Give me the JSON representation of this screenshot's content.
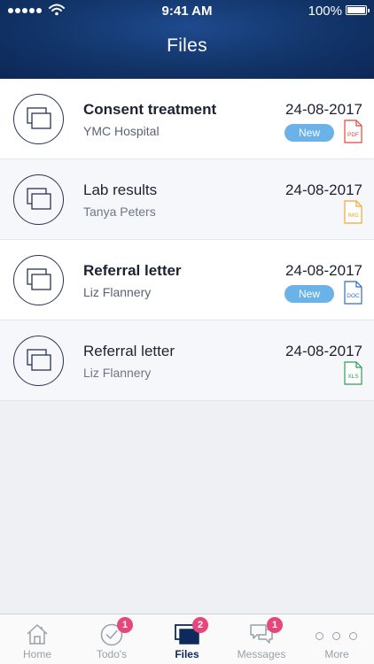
{
  "status_bar": {
    "time": "9:41 AM",
    "battery": "100%"
  },
  "header": {
    "title": "Files"
  },
  "files": [
    {
      "title": "Consent treatment",
      "subtitle": "YMC Hospital",
      "date": "24-08-2017",
      "badge": "New",
      "file_type": "PDF",
      "file_color": "#e0473a",
      "unread": true
    },
    {
      "title": "Lab results",
      "subtitle": "Tanya Peters",
      "date": "24-08-2017",
      "badge": "",
      "file_type": "IMG",
      "file_color": "#f0a830",
      "unread": false
    },
    {
      "title": "Referral letter",
      "subtitle": "Liz Flannery",
      "date": "24-08-2017",
      "badge": "New",
      "file_type": "DOC",
      "file_color": "#2f6fb7",
      "unread": true
    },
    {
      "title": "Referral letter",
      "subtitle": "Liz Flannery",
      "date": "24-08-2017",
      "badge": "",
      "file_type": "XLS",
      "file_color": "#2e9e57",
      "unread": false
    }
  ],
  "tabs": [
    {
      "label": "Home",
      "icon": "home-icon",
      "badge": ""
    },
    {
      "label": "Todo's",
      "icon": "check-circle-icon",
      "badge": "1"
    },
    {
      "label": "Files",
      "icon": "files-icon",
      "badge": "2",
      "active": true
    },
    {
      "label": "Messages",
      "icon": "messages-icon",
      "badge": "1"
    },
    {
      "label": "More",
      "icon": "more-icon",
      "badge": ""
    }
  ],
  "colors": {
    "header_bg": "#123468",
    "new_badge": "#6bb2e8",
    "tab_badge": "#e5467c",
    "tab_active": "#0e2a5c",
    "tab_inactive": "#9aa0aa"
  }
}
